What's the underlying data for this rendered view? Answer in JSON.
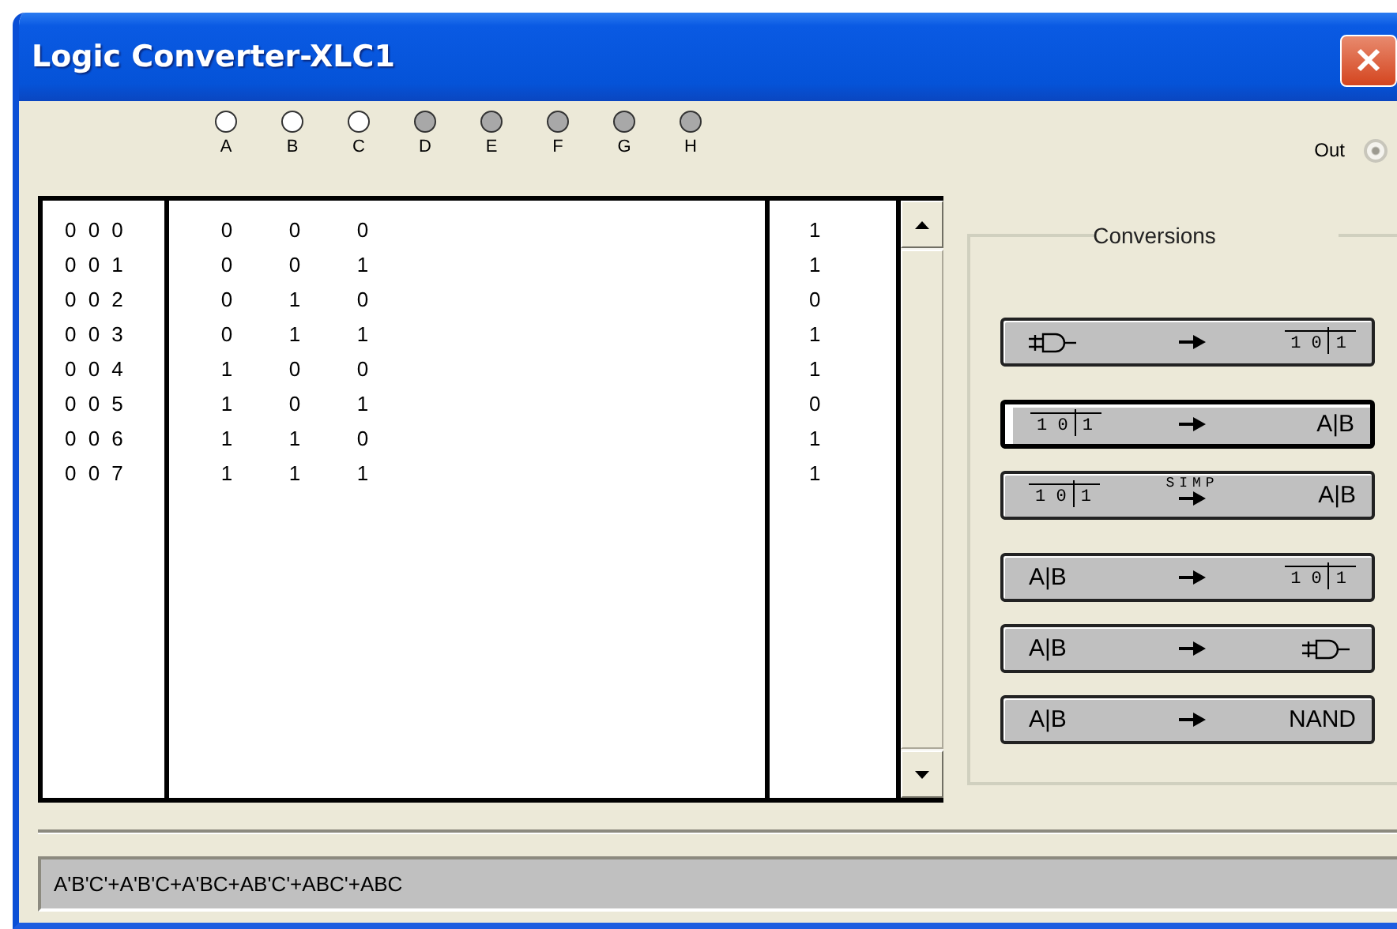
{
  "window": {
    "title": "Logic Converter-XLC1"
  },
  "inputs": [
    {
      "label": "A",
      "active": true
    },
    {
      "label": "B",
      "active": true
    },
    {
      "label": "C",
      "active": true
    },
    {
      "label": "D",
      "active": false
    },
    {
      "label": "E",
      "active": false
    },
    {
      "label": "F",
      "active": false
    },
    {
      "label": "G",
      "active": false
    },
    {
      "label": "H",
      "active": false
    }
  ],
  "output": {
    "label": "Out",
    "on": false
  },
  "truth_table": {
    "rows": [
      {
        "index": "0 0 0",
        "values": [
          "0",
          "0",
          "0"
        ],
        "output": "1"
      },
      {
        "index": "0 0 1",
        "values": [
          "0",
          "0",
          "1"
        ],
        "output": "1"
      },
      {
        "index": "0 0 2",
        "values": [
          "0",
          "1",
          "0"
        ],
        "output": "0"
      },
      {
        "index": "0 0 3",
        "values": [
          "0",
          "1",
          "1"
        ],
        "output": "1"
      },
      {
        "index": "0 0 4",
        "values": [
          "1",
          "0",
          "0"
        ],
        "output": "1"
      },
      {
        "index": "0 0 5",
        "values": [
          "1",
          "0",
          "1"
        ],
        "output": "0"
      },
      {
        "index": "0 0 6",
        "values": [
          "1",
          "1",
          "0"
        ],
        "output": "1"
      },
      {
        "index": "0 0 7",
        "values": [
          "1",
          "1",
          "1"
        ],
        "output": "1"
      }
    ]
  },
  "conversions": {
    "title": "Conversions",
    "buttons": [
      {
        "from": {
          "kind": "gate"
        },
        "to": {
          "kind": "table",
          "digits": [
            "1 0",
            "1"
          ]
        },
        "selected": false
      },
      {
        "from": {
          "kind": "table",
          "digits": [
            "1 0",
            "1"
          ]
        },
        "to": {
          "kind": "text",
          "text": "A|B"
        },
        "selected": true
      },
      {
        "from": {
          "kind": "table",
          "digits": [
            "1 0",
            "1"
          ]
        },
        "to": {
          "kind": "text",
          "text": "A|B"
        },
        "arrow_label": "SIMP",
        "selected": false
      },
      {
        "from": {
          "kind": "text",
          "text": "A|B"
        },
        "to": {
          "kind": "table",
          "digits": [
            "1 0",
            "1"
          ]
        },
        "selected": false
      },
      {
        "from": {
          "kind": "text",
          "text": "A|B"
        },
        "to": {
          "kind": "gate"
        },
        "selected": false
      },
      {
        "from": {
          "kind": "text",
          "text": "A|B"
        },
        "to": {
          "kind": "text",
          "text": "NAND"
        },
        "selected": false
      }
    ]
  },
  "expression": {
    "value": "A'B'C'+A'B'C+A'BC+AB'C'+ABC'+ABC"
  }
}
